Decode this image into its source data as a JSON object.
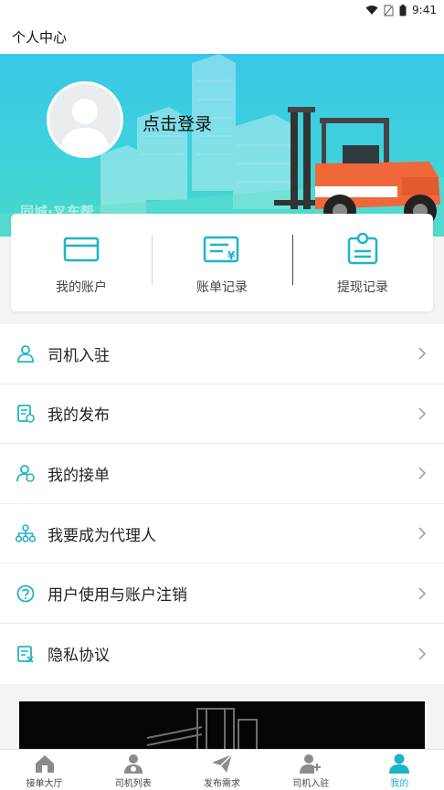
{
  "status_bar": {
    "time": "9:41"
  },
  "header": {
    "title": "个人中心"
  },
  "profile": {
    "login_text": "点击登录",
    "brand_text": "同城·叉车帮"
  },
  "quick_actions": [
    {
      "label": "我的账户",
      "icon": "wallet-card-icon"
    },
    {
      "label": "账单记录",
      "icon": "bill-icon"
    },
    {
      "label": "提现记录",
      "icon": "withdraw-record-icon"
    }
  ],
  "menu": [
    {
      "label": "司机入驻",
      "icon": "driver-join-icon"
    },
    {
      "label": "我的发布",
      "icon": "my-publish-icon"
    },
    {
      "label": "我的接单",
      "icon": "my-orders-icon"
    },
    {
      "label": "我要成为代理人",
      "icon": "agent-network-icon"
    },
    {
      "label": "用户使用与账户注销",
      "icon": "help-question-icon"
    },
    {
      "label": "隐私协议",
      "icon": "privacy-doc-icon"
    }
  ],
  "tabbar": [
    {
      "label": "接单大厅",
      "icon": "home-icon",
      "active": false
    },
    {
      "label": "司机列表",
      "icon": "driver-list-icon",
      "active": false
    },
    {
      "label": "发布需求",
      "icon": "send-icon",
      "active": false
    },
    {
      "label": "司机入驻",
      "icon": "driver-add-icon",
      "active": false
    },
    {
      "label": "我的",
      "icon": "user-icon",
      "active": true
    }
  ],
  "colors": {
    "accent": "#1eb4c8",
    "banner_top": "#38c7e6",
    "banner_bottom": "#45d8c7"
  }
}
